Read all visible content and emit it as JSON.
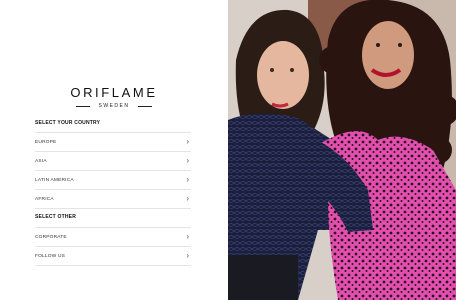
{
  "brand": {
    "name": "ORIFLAME",
    "sub": "SWEDEN"
  },
  "countries": {
    "heading": "SELECT YOUR COUNTRY",
    "items": [
      {
        "label": "EUROPE"
      },
      {
        "label": "ASIA"
      },
      {
        "label": "LATIN AMERICA"
      },
      {
        "label": "AFRICA"
      }
    ]
  },
  "other": {
    "heading": "SELECT OTHER",
    "items": [
      {
        "label": "CORPORATE"
      },
      {
        "label": "FOLLOW US"
      }
    ]
  },
  "icons": {
    "chevron": "chevron-right-icon"
  },
  "colors": {
    "text": "#222222",
    "divider": "#e4e4e4",
    "dress_pink": "#e24fae"
  }
}
